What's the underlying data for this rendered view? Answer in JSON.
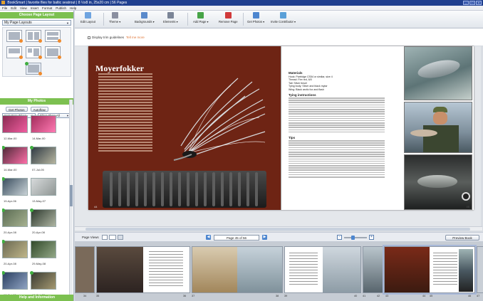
{
  "window": {
    "title": "BookSmart | favorite flies for baltic seatrout | 8 ½x8 in, 25x20 cm | 56 Pages",
    "controls": [
      "_",
      "□",
      "x"
    ]
  },
  "menu": [
    "File",
    "Edit",
    "View",
    "Insert",
    "Format",
    "Publish",
    "Help"
  ],
  "sidebar": {
    "layouts_header": "Choose Page Layout",
    "layouts_select": "My Page Layouts",
    "photos_header": "My Photos",
    "get_photos": "Get Photos",
    "autoflow": "Autoflow",
    "sort_select": "Sort: Date Taken",
    "filter_select": "Filter: Show All",
    "photos": [
      {
        "cap": "12-Mar-00",
        "c1": "#8a2b52",
        "c2": "#f05ea0"
      },
      {
        "cap": "14-Mar-00",
        "c1": "#a32e5c",
        "c2": "#ff7ab3"
      },
      {
        "cap": "14-Mar-00",
        "c1": "#4f2a38",
        "c2": "#ff6fa9"
      },
      {
        "cap": "07-Jul-05",
        "c1": "#2f3a44",
        "c2": "#b7b6a0"
      },
      {
        "cap": "19-Apr-06",
        "c1": "#3b4f60",
        "c2": "#c9d2d6"
      },
      {
        "cap": "13-May-07",
        "c1": "#d7dadb",
        "c2": "#8f9694"
      },
      {
        "cap": "20-Apr-08",
        "c1": "#5c6d54",
        "c2": "#a6b190"
      },
      {
        "cap": "20-Apr-08",
        "c1": "#2e3a2f",
        "c2": "#aeb5a2"
      },
      {
        "cap": "20-Apr-08",
        "c1": "#6b6a52",
        "c2": "#c0b68a"
      },
      {
        "cap": "29-May-08",
        "c1": "#324a2b",
        "c2": "#93a887"
      },
      {
        "cap": "16-Oct-00",
        "c1": "#2b4062",
        "c2": "#8fa3c2"
      },
      {
        "cap": "16-Oct-07",
        "c1": "#3a3c33",
        "c2": "#a49870"
      }
    ],
    "bottom": "Help and Information"
  },
  "toolbar": [
    {
      "label": "Edit Layout",
      "color": "#6ea4e0"
    },
    {
      "label": "Theme ▾",
      "color": "#8a8fa0"
    },
    {
      "label": "Backgrounds ▾",
      "color": "#5a8acb"
    },
    {
      "label": "Elements ▾",
      "color": "#7b8597"
    },
    {
      "label": "Add Page ▾",
      "color": "#47a447"
    },
    {
      "label": "Remove Page",
      "color": "#d13a3a"
    },
    {
      "label": "Get Photos ▾",
      "color": "#4d86cf"
    },
    {
      "label": "Invite Contributor ▾",
      "color": "#5aa0d8"
    }
  ],
  "canvas": {
    "guides_label": "Display trim guidelines",
    "guides_tip": "Tell me more",
    "left_title": "Moyerfokker",
    "left_page_no": "44",
    "right_page_no": "45",
    "right_headings": [
      "Materials",
      "Tying instructions",
      "Tips"
    ],
    "materials": [
      "Hook: Partridge CS54 or similar, size 4",
      "Thread: Fire red, 6/0",
      "Tail: Silver tinsel",
      "Tying body: Silver and black mylar",
      "Wing: Black arctic fox and flash"
    ]
  },
  "navbar": {
    "page_views": "Page Views",
    "page_field": "Page 45 of 56",
    "preview_button": "Preview Book"
  },
  "filmstrip": {
    "numbers": [
      "34",
      "35",
      "36",
      "37",
      "38",
      "39",
      "40",
      "41",
      "42",
      "43",
      "44",
      "45",
      "46",
      "47"
    ]
  },
  "colors": {
    "accent_green": "#7cc050",
    "title_bar": "#1f3f8f",
    "page_red": "#6e2414"
  }
}
